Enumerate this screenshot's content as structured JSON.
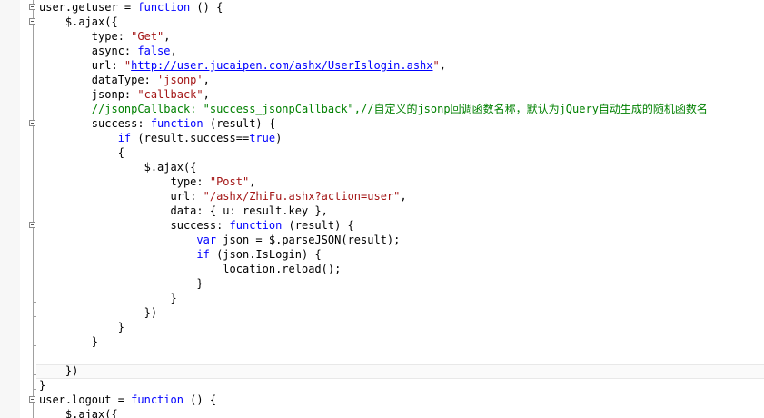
{
  "editor": {
    "lines": [
      [
        {
          "t": "user.getuser = ",
          "c": ""
        },
        {
          "t": "function",
          "c": "kw"
        },
        {
          "t": " () {",
          "c": ""
        }
      ],
      [
        {
          "t": "    $.ajax({",
          "c": ""
        }
      ],
      [
        {
          "t": "        type: ",
          "c": ""
        },
        {
          "t": "\"Get\"",
          "c": "str"
        },
        {
          "t": ",",
          "c": ""
        }
      ],
      [
        {
          "t": "        async: ",
          "c": ""
        },
        {
          "t": "false",
          "c": "kw"
        },
        {
          "t": ",",
          "c": ""
        }
      ],
      [
        {
          "t": "        url: ",
          "c": ""
        },
        {
          "t": "\"",
          "c": "str"
        },
        {
          "t": "http://user.jucaipen.com/ashx/UserIslogin.ashx",
          "c": "url"
        },
        {
          "t": "\"",
          "c": "str"
        },
        {
          "t": ",",
          "c": ""
        }
      ],
      [
        {
          "t": "        dataType: ",
          "c": ""
        },
        {
          "t": "'jsonp'",
          "c": "str"
        },
        {
          "t": ",",
          "c": ""
        }
      ],
      [
        {
          "t": "        jsonp: ",
          "c": ""
        },
        {
          "t": "\"callback\"",
          "c": "str"
        },
        {
          "t": ",",
          "c": ""
        }
      ],
      [
        {
          "t": "        //jsonpCallback: \"success_jsonpCallback\",//自定义的jsonp回调函数名称，默认为jQuery自动生成的随机函数名",
          "c": "cmt"
        }
      ],
      [
        {
          "t": "        success: ",
          "c": ""
        },
        {
          "t": "function",
          "c": "kw"
        },
        {
          "t": " (result) {",
          "c": ""
        }
      ],
      [
        {
          "t": "            ",
          "c": ""
        },
        {
          "t": "if",
          "c": "kw"
        },
        {
          "t": " (result.success==",
          "c": ""
        },
        {
          "t": "true",
          "c": "kw"
        },
        {
          "t": ")",
          "c": ""
        }
      ],
      [
        {
          "t": "            {",
          "c": ""
        }
      ],
      [
        {
          "t": "                $.ajax({",
          "c": ""
        }
      ],
      [
        {
          "t": "                    type: ",
          "c": ""
        },
        {
          "t": "\"Post\"",
          "c": "str"
        },
        {
          "t": ",",
          "c": ""
        }
      ],
      [
        {
          "t": "                    url: ",
          "c": ""
        },
        {
          "t": "\"/ashx/ZhiFu.ashx?action=user\"",
          "c": "str"
        },
        {
          "t": ",",
          "c": ""
        }
      ],
      [
        {
          "t": "                    data: { u: result.key },",
          "c": ""
        }
      ],
      [
        {
          "t": "                    success: ",
          "c": ""
        },
        {
          "t": "function",
          "c": "kw"
        },
        {
          "t": " (result) {",
          "c": ""
        }
      ],
      [
        {
          "t": "                        ",
          "c": ""
        },
        {
          "t": "var",
          "c": "kw"
        },
        {
          "t": " json = $.parseJSON(result);",
          "c": ""
        }
      ],
      [
        {
          "t": "                        ",
          "c": ""
        },
        {
          "t": "if",
          "c": "kw"
        },
        {
          "t": " (json.IsLogin) {",
          "c": ""
        }
      ],
      [
        {
          "t": "                            location.reload();",
          "c": ""
        }
      ],
      [
        {
          "t": "                        }",
          "c": ""
        }
      ],
      [
        {
          "t": "                    }",
          "c": ""
        }
      ],
      [
        {
          "t": "                })",
          "c": ""
        }
      ],
      [
        {
          "t": "            }",
          "c": ""
        }
      ],
      [
        {
          "t": "        }",
          "c": ""
        }
      ],
      [
        {
          "t": "",
          "c": ""
        }
      ],
      [
        {
          "t": "    })",
          "c": ""
        }
      ],
      [
        {
          "t": "}",
          "c": ""
        }
      ],
      [
        {
          "t": "user.logout = ",
          "c": ""
        },
        {
          "t": "function",
          "c": "kw"
        },
        {
          "t": " () {",
          "c": ""
        }
      ],
      [
        {
          "t": "    $.ajax({",
          "c": ""
        }
      ]
    ]
  }
}
